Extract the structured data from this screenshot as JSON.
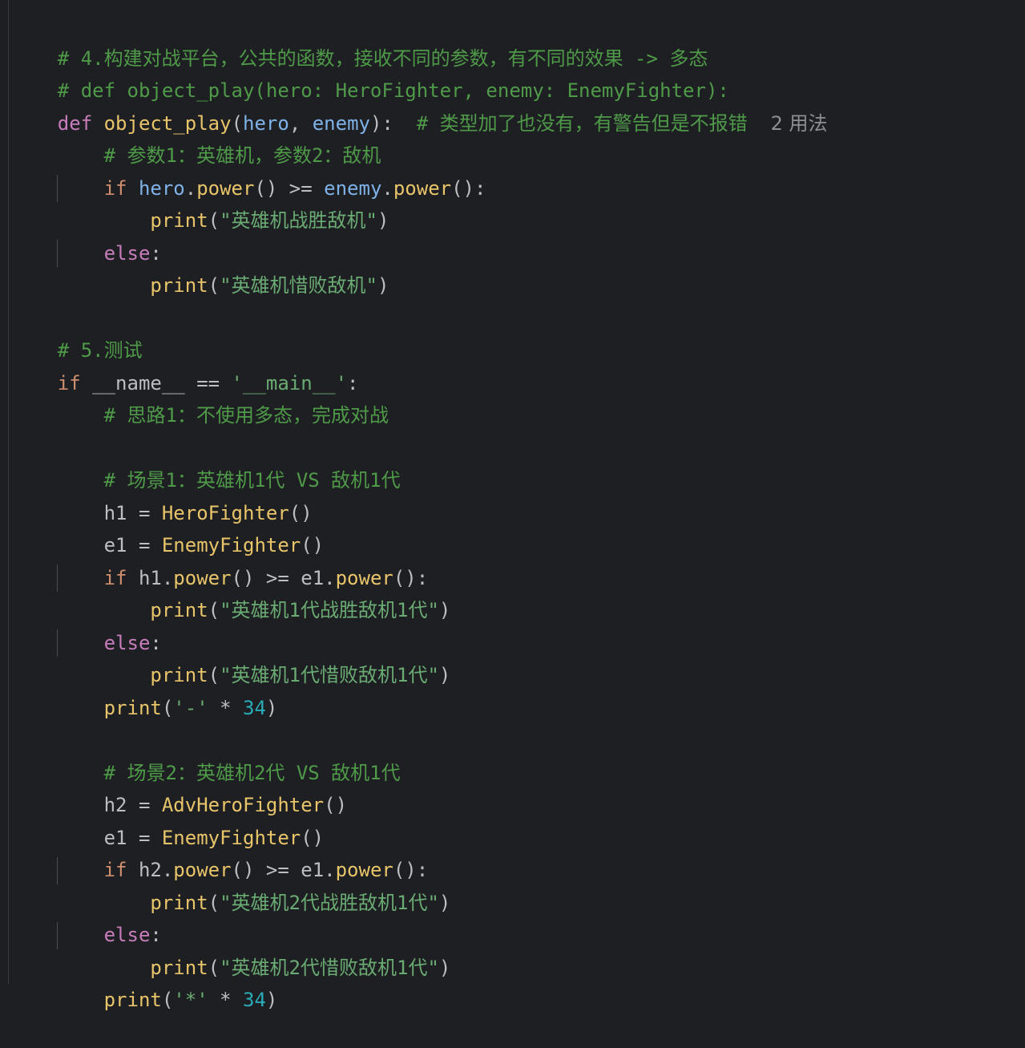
{
  "code": {
    "l1_comment": "# 4.构建对战平台，公共的函数，接收不同的参数，有不同的效果 -> 多态",
    "l2_comment": "# def object_play(hero: HeroFighter, enemy: EnemyFighter):",
    "l3": {
      "kw": "def",
      "name": "object_play",
      "open": "(",
      "p1": "hero",
      "comma": ", ",
      "p2": "enemy",
      "close": "):",
      "comment": "# 类型加了也没有，有警告但是不报错",
      "usages": "2 用法"
    },
    "l4_comment": "# 参数1：英雄机，参数2：敌机",
    "l5": {
      "kw": "if",
      "a": "hero",
      "dot1": ".",
      "m1": "power",
      "mid": "() >= ",
      "b": "enemy",
      "dot2": ".",
      "m2": "power",
      "end": "():"
    },
    "l6": {
      "fn": "print",
      "open": "(",
      "str": "\"英雄机战胜敌机\"",
      "close": ")"
    },
    "l7": {
      "kw": "else",
      "colon": ":"
    },
    "l8": {
      "fn": "print",
      "open": "(",
      "str": "\"英雄机惜败敌机\"",
      "close": ")"
    },
    "l10_comment": "# 5.测试",
    "l11": {
      "kw": "if",
      "var": " __name__ == ",
      "str": "'__main__'",
      "colon": ":"
    },
    "l12_comment": "# 思路1：不使用多态，完成对战",
    "l14_comment": "# 场景1：英雄机1代 VS 敌机1代",
    "l15": {
      "var": "h1 = ",
      "cls": "HeroFighter",
      "paren": "()"
    },
    "l16": {
      "var": "e1 = ",
      "cls": "EnemyFighter",
      "paren": "()"
    },
    "l17": {
      "kw": "if",
      "a": " h1.",
      "m1": "power",
      "mid": "() >= e1.",
      "m2": "power",
      "end": "():"
    },
    "l18": {
      "fn": "print",
      "open": "(",
      "str": "\"英雄机1代战胜敌机1代\"",
      "close": ")"
    },
    "l19": {
      "kw": "else",
      "colon": ":"
    },
    "l20": {
      "fn": "print",
      "open": "(",
      "str": "\"英雄机1代惜败敌机1代\"",
      "close": ")"
    },
    "l21": {
      "fn": "print",
      "open": "(",
      "str": "'-'",
      "op": " * ",
      "num": "34",
      "close": ")"
    },
    "l23_comment": "# 场景2：英雄机2代 VS 敌机1代",
    "l24": {
      "var": "h2 = ",
      "cls": "AdvHeroFighter",
      "paren": "()"
    },
    "l25": {
      "var": "e1 = ",
      "cls": "EnemyFighter",
      "paren": "()"
    },
    "l26": {
      "kw": "if",
      "a": " h2.",
      "m1": "power",
      "mid": "() >= e1.",
      "m2": "power",
      "end": "():"
    },
    "l27": {
      "fn": "print",
      "open": "(",
      "str": "\"英雄机2代战胜敌机1代\"",
      "close": ")"
    },
    "l28": {
      "kw": "else",
      "colon": ":"
    },
    "l29": {
      "fn": "print",
      "open": "(",
      "str": "\"英雄机2代惜败敌机1代\"",
      "close": ")"
    },
    "l30": {
      "fn": "print",
      "open": "(",
      "str": "'*'",
      "op": " * ",
      "num": "34",
      "close": ")"
    }
  },
  "colors": {
    "background": "#1e1f22",
    "keyword": "#cf8e6d",
    "keyword_else": "#c77dbb",
    "function": "#e8c46a",
    "parameter": "#7fb2e8",
    "string": "#6aab73",
    "number": "#2aacb8",
    "comment": "#4f9a49",
    "text": "#bcbec4"
  }
}
